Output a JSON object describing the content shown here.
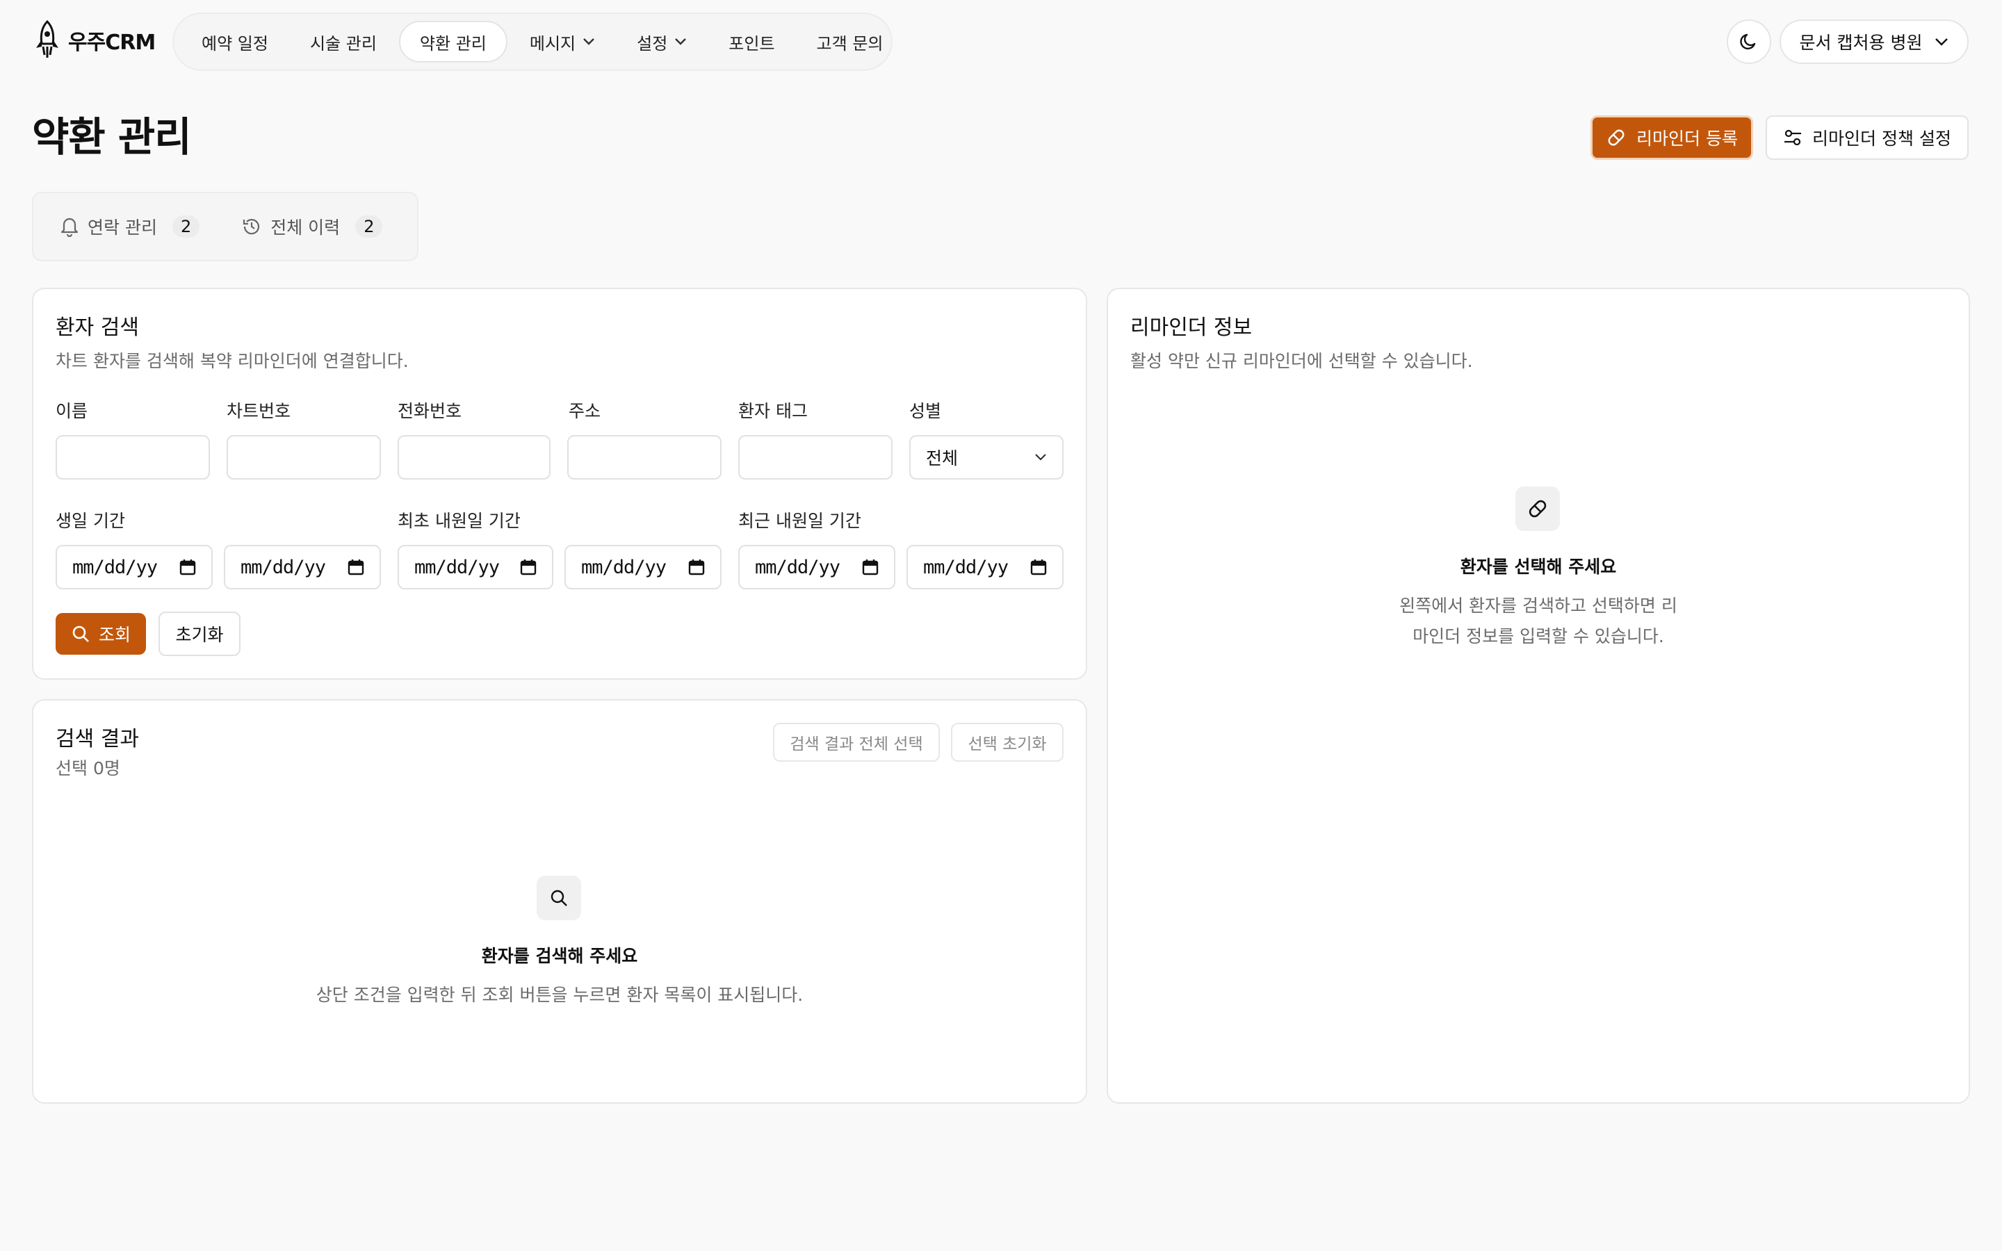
{
  "app": {
    "name": "우주CRM"
  },
  "nav": {
    "items": [
      {
        "label": "예약 일정"
      },
      {
        "label": "시술 관리"
      },
      {
        "label": "약환 관리"
      },
      {
        "label": "메시지"
      },
      {
        "label": "설정"
      },
      {
        "label": "포인트"
      },
      {
        "label": "고객 문의"
      }
    ]
  },
  "header": {
    "org_name": "문서 캡처용 병원",
    "theme_icon": "moon-icon"
  },
  "page": {
    "title": "약환 관리"
  },
  "actions": {
    "register": "리마인더 등록",
    "policy": "리마인더 정책 설정"
  },
  "tabs": [
    {
      "label": "연락 관리",
      "count": "2",
      "icon": "bell-icon"
    },
    {
      "label": "전체 이력",
      "count": "2",
      "icon": "history-icon"
    }
  ],
  "search": {
    "title": "환자 검색",
    "desc": "차트 환자를 검색해 복약 리마인더에 연결합니다.",
    "fields": {
      "name": "이름",
      "chart_no": "차트번호",
      "phone": "전화번호",
      "address": "주소",
      "tag": "환자 태그",
      "gender": "성별"
    },
    "gender_value": "전체",
    "date_labels": {
      "birthday": "생일 기간",
      "first_visit": "최초 내원일 기간",
      "recent_visit": "최근 내원일 기간"
    },
    "date_placeholder": "mm/dd/yy",
    "search_btn": "조회",
    "reset_btn": "초기화"
  },
  "results": {
    "title": "검색 결과",
    "selected": "선택 0명",
    "select_all": "검색 결과 전체 선택",
    "clear_selection": "선택 초기화",
    "empty_title": "환자를 검색해 주세요",
    "empty_desc": "상단 조건을 입력한 뒤 조회 버튼을 누르면 환자 목록이 표시됩니다."
  },
  "reminder": {
    "title": "리마인더 정보",
    "desc": "활성 약만 신규 리마인더에 선택할 수 있습니다.",
    "empty_title": "환자를 선택해 주세요",
    "empty_desc_1": "왼쪽에서 환자를 검색하고 선택하면 리",
    "empty_desc_2": "마인더 정보를 입력할 수 있습니다."
  },
  "colors": {
    "accent": "#c2570c",
    "background": "#f9f9f9"
  }
}
